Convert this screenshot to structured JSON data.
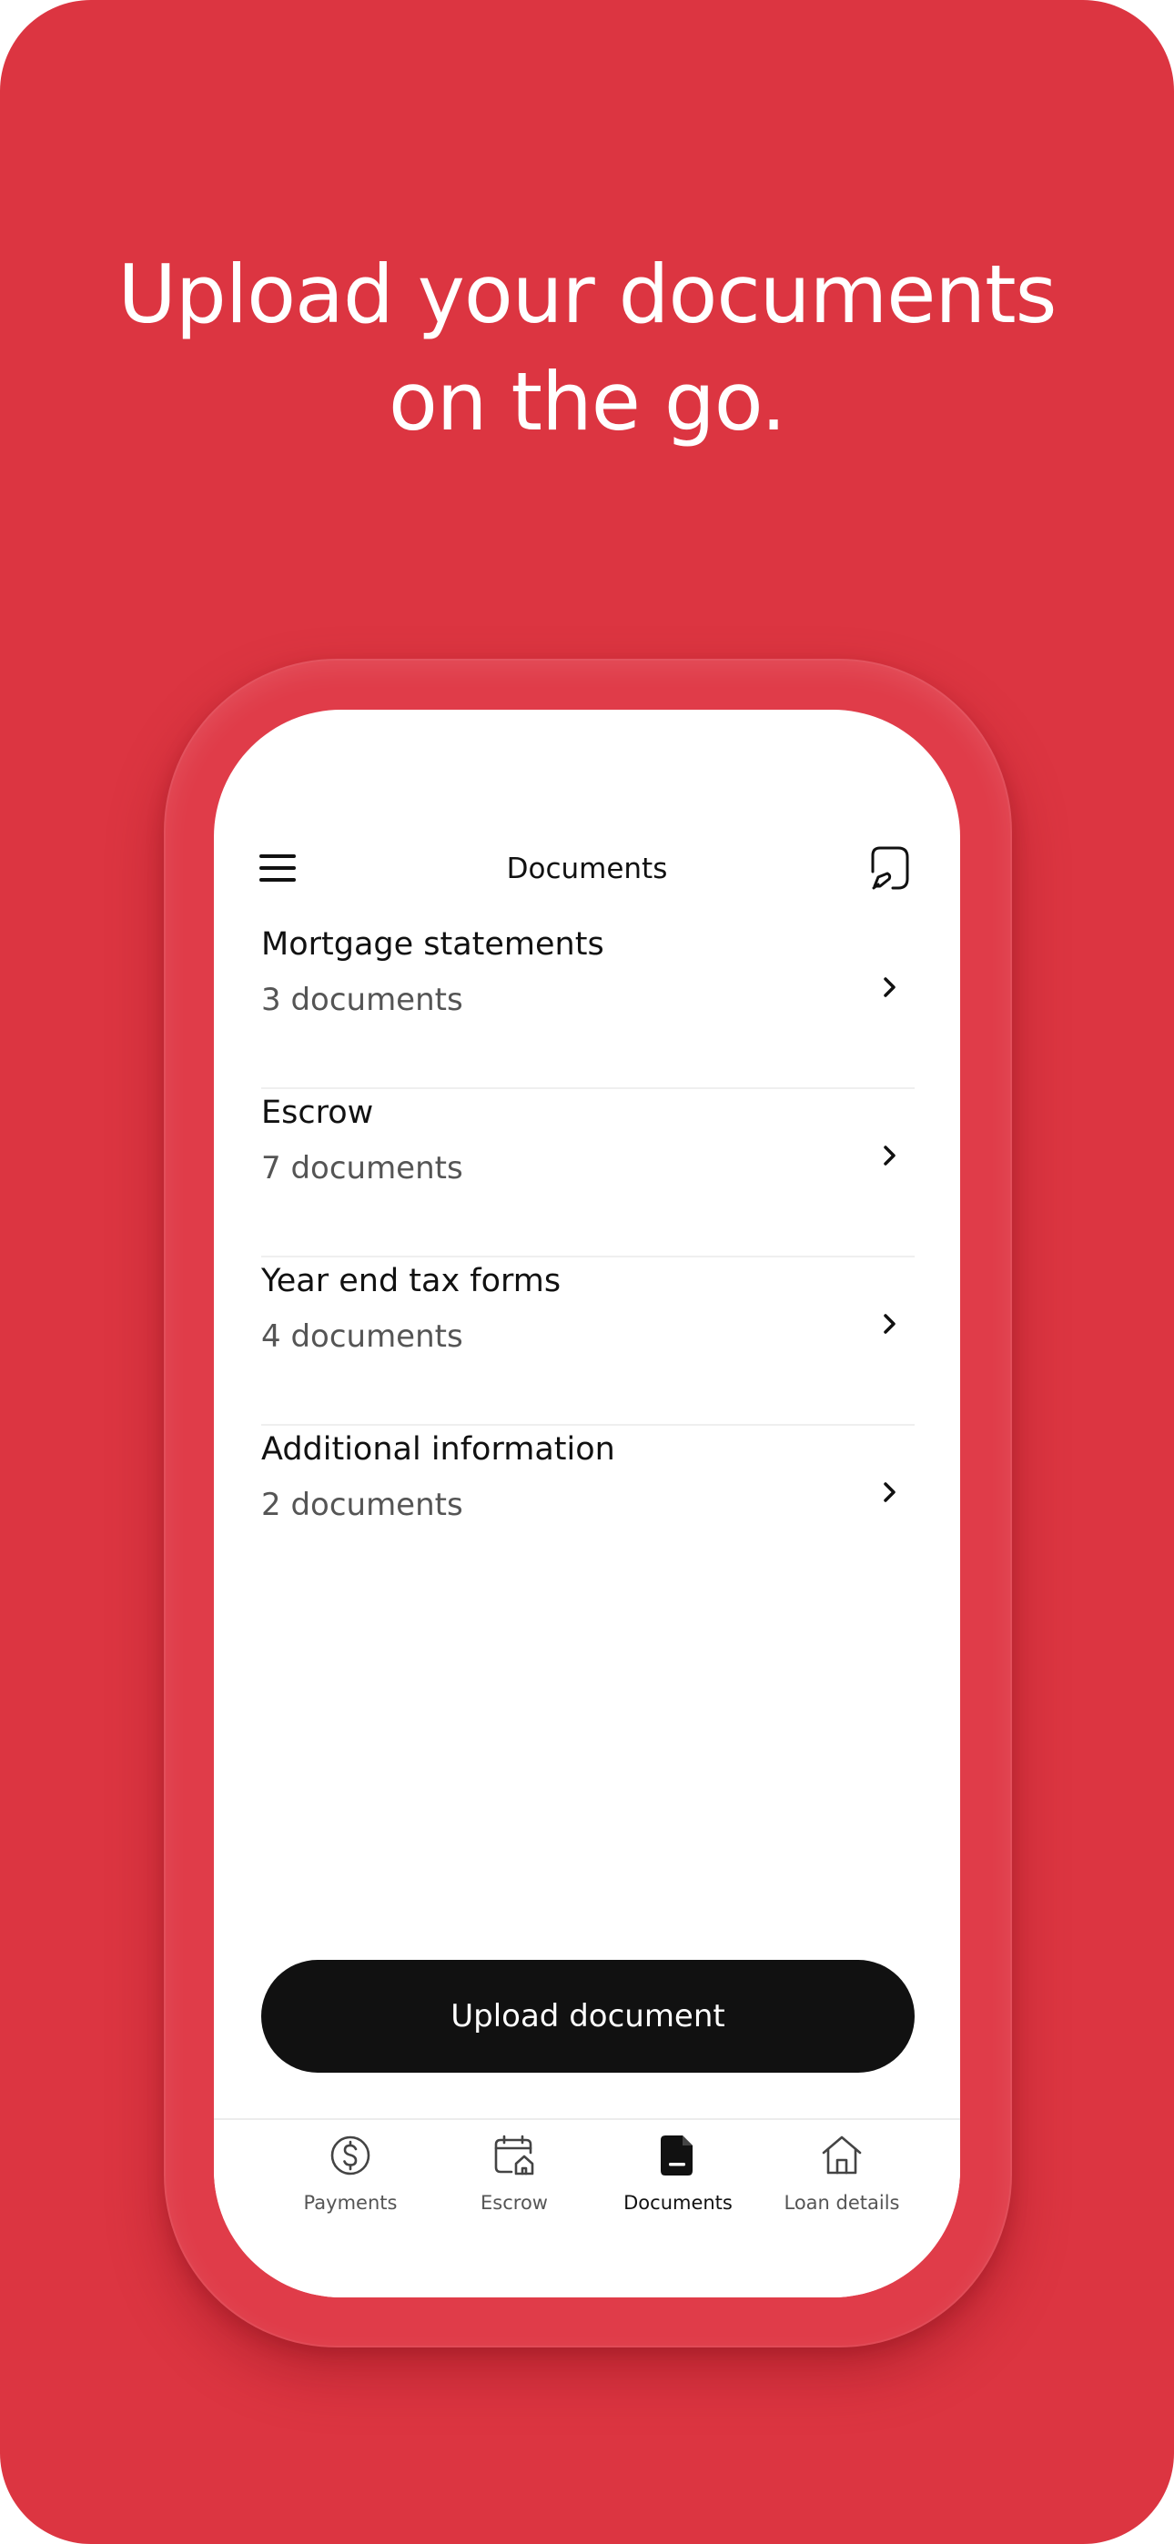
{
  "headline": {
    "line1": "Upload your documents",
    "line2": "on the go."
  },
  "nav": {
    "title": "Documents",
    "menu_icon": "hamburger-menu-icon",
    "action_icon": "document-edit-icon"
  },
  "documents": [
    {
      "title": "Mortgage statements",
      "count": "3 documents"
    },
    {
      "title": "Escrow",
      "count": "7 documents"
    },
    {
      "title": "Year end tax forms",
      "count": "4 documents"
    },
    {
      "title": "Additional information",
      "count": "2 documents"
    }
  ],
  "upload_button": {
    "label": "Upload document"
  },
  "tabs": [
    {
      "label": "Payments",
      "icon": "dollar-circle-icon",
      "active": false
    },
    {
      "label": "Escrow",
      "icon": "calendar-home-icon",
      "active": false
    },
    {
      "label": "Documents",
      "icon": "document-icon",
      "active": true
    },
    {
      "label": "Loan details",
      "icon": "home-icon",
      "active": false
    }
  ],
  "colors": {
    "background": "#dc3541",
    "primary_button": "#111111",
    "text_primary": "#111111",
    "text_secondary": "#555555"
  }
}
